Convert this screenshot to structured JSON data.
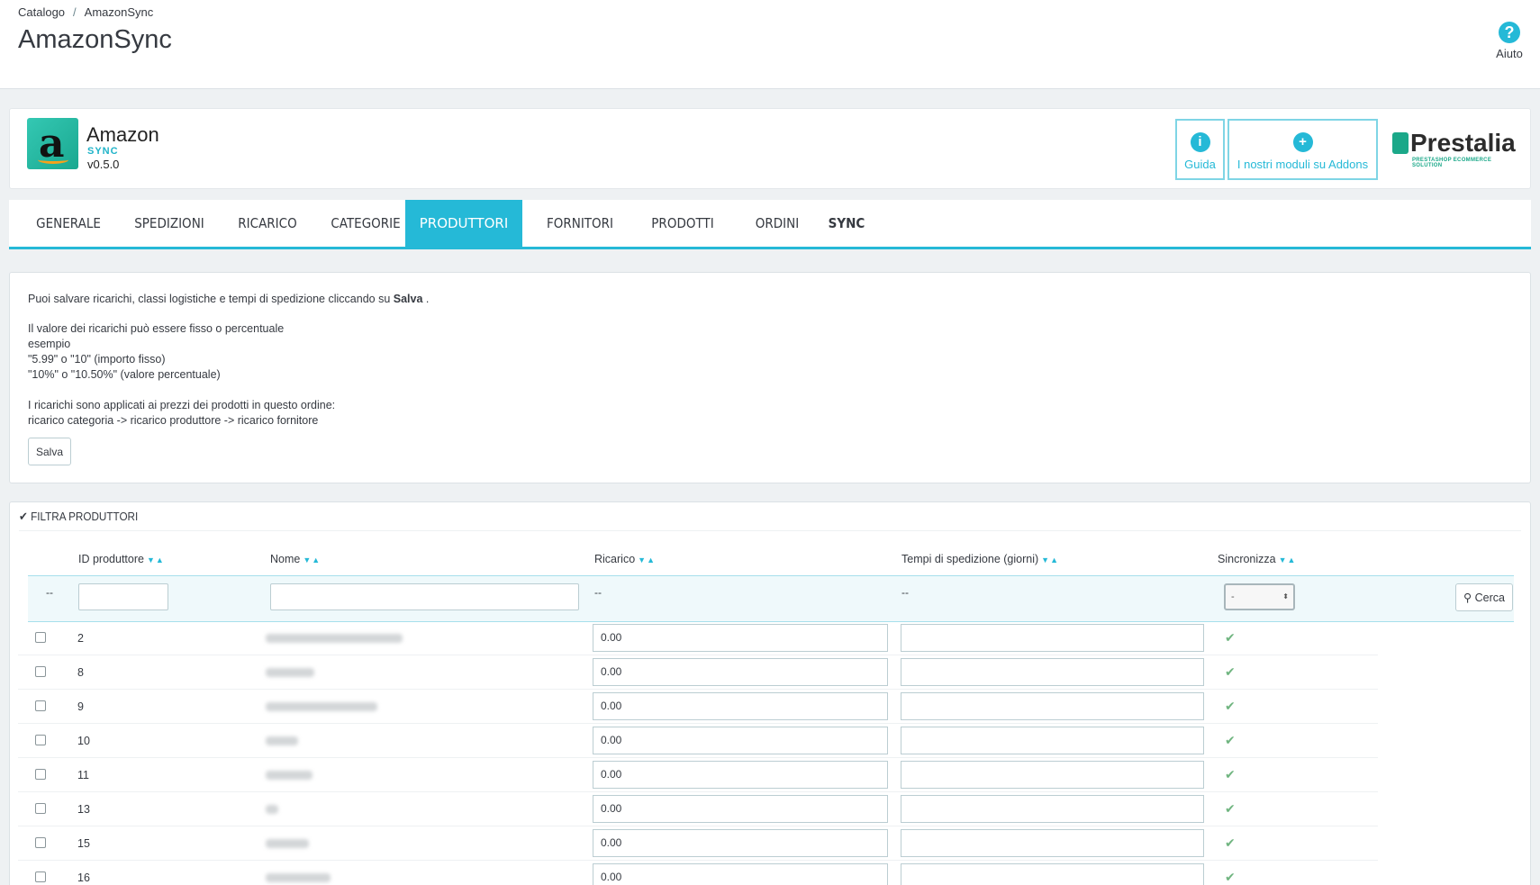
{
  "breadcrumb": {
    "parent": "Catalogo",
    "current": "AmazonSync",
    "separator": "/"
  },
  "page_title": "AmazonSync",
  "help": {
    "icon": "?",
    "label": "Aiuto"
  },
  "module": {
    "name": "Amazon",
    "sub": "SYNC",
    "version": "v0.5.0",
    "guida_label": "Guida",
    "guida_icon": "i",
    "addons_label": "I nostri moduli su Addons",
    "addons_icon": "+",
    "brand": "Prestalia",
    "brand_tagline": "PRESTASHOP ECOMMERCE SOLUTION"
  },
  "tabs": [
    "GENERALE",
    "SPEDIZIONI",
    "RICARICO",
    "CATEGORIE",
    "PRODUTTORI",
    "FORNITORI",
    "PRODOTTI",
    "ORDINI",
    "SYNC"
  ],
  "active_tab": "PRODUTTORI",
  "info": {
    "line1_pre": "Puoi salvare ricarichi, classi logistiche e tempi di spedizione cliccando su",
    "line1_bold": "Salva",
    "line1_post": ".",
    "line2": "Il valore dei ricarichi può essere fisso o percentuale",
    "line3": "esempio",
    "line4": "\"5.99\" o \"10\" (importo fisso)",
    "line5": "\"10%\" o \"10.50%\" (valore percentuale)",
    "line6": "I ricarichi sono applicati ai prezzi dei prodotti in questo ordine:",
    "line7": "ricarico categoria -> ricarico produttore -> ricarico fornitore",
    "save_label": "Salva"
  },
  "filter": {
    "title": "FILTRA PRODUTTORI",
    "columns": [
      "ID produttore",
      "Nome",
      "Ricarico",
      "Tempi di spedizione (giorni)",
      "Sincronizza"
    ],
    "sort_glyph": "▼▲",
    "dash": "--",
    "select_value": "-",
    "search_label": "Cerca"
  },
  "rows": [
    {
      "id": "2",
      "ricarico": "0.00"
    },
    {
      "id": "8",
      "ricarico": "0.00"
    },
    {
      "id": "9",
      "ricarico": "0.00"
    },
    {
      "id": "10",
      "ricarico": "0.00"
    },
    {
      "id": "11",
      "ricarico": "0.00"
    },
    {
      "id": "13",
      "ricarico": "0.00"
    },
    {
      "id": "15",
      "ricarico": "0.00"
    },
    {
      "id": "16",
      "ricarico": "0.00"
    }
  ],
  "colors": {
    "accent": "#25b9d7",
    "check": "#70b580"
  }
}
